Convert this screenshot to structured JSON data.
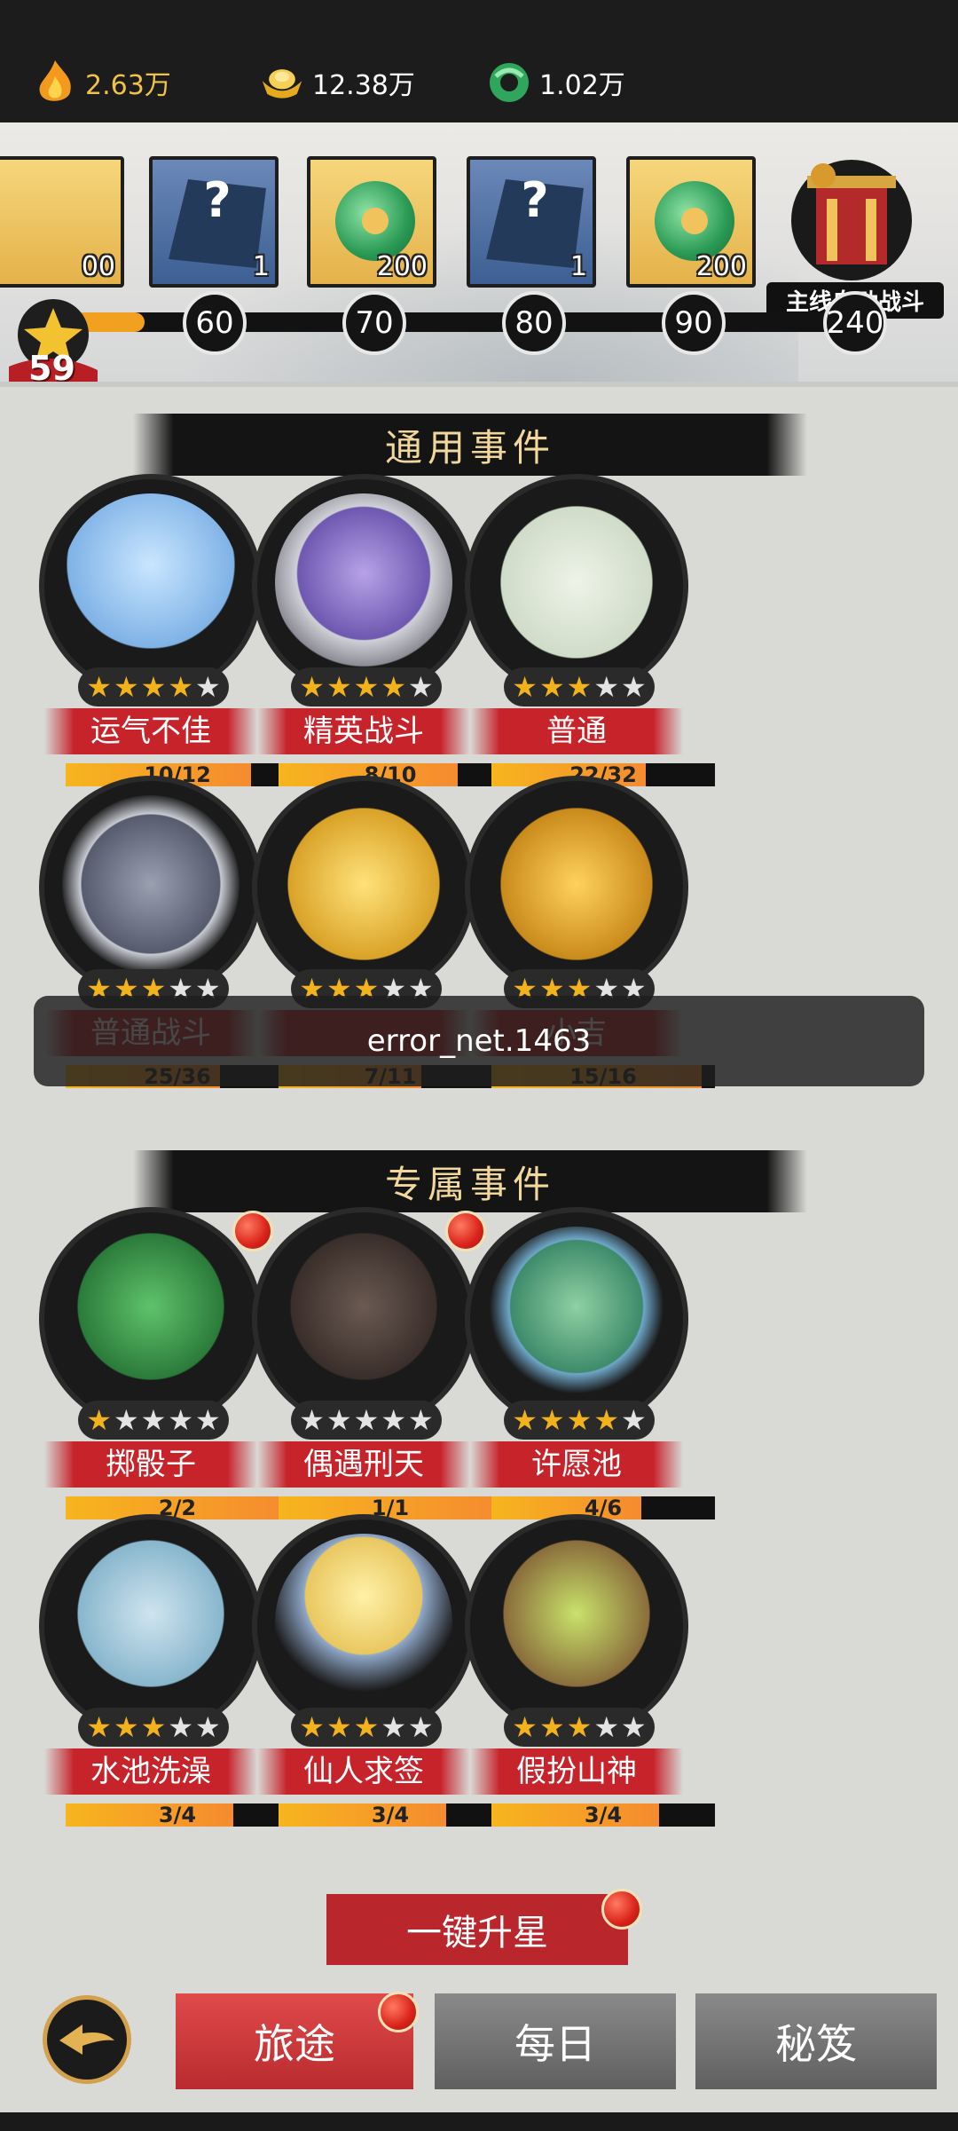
{
  "resources": [
    {
      "icon": "fire-icon",
      "value": "2.63万"
    },
    {
      "icon": "gold-ingot-icon",
      "value": "12.38万"
    },
    {
      "icon": "jade-icon",
      "value": "1.02万"
    }
  ],
  "track": {
    "level": "59",
    "partial_count": "00",
    "rewards": [
      {
        "type": "mystery",
        "count": "1"
      },
      {
        "type": "jade",
        "count": "200"
      },
      {
        "type": "mystery",
        "count": "1"
      },
      {
        "type": "jade",
        "count": "200"
      }
    ],
    "ticks": [
      "60",
      "70",
      "80",
      "90",
      "240"
    ],
    "progress_fraction": 0.09,
    "auto_battle_label": "主线自动战斗"
  },
  "sections": {
    "common_title": "通用事件",
    "exclusive_title": "专属事件"
  },
  "common_events": [
    {
      "name": "运气不佳",
      "stars": 4,
      "progress": "10/12",
      "ratio": 0.83,
      "art": "ghost"
    },
    {
      "name": "精英战斗",
      "stars": 4,
      "progress": "8/10",
      "ratio": 0.8,
      "art": "skull"
    },
    {
      "name": "普通",
      "stars": 3,
      "progress": "22/32",
      "ratio": 0.69,
      "art": "scroll"
    },
    {
      "name": "普通战斗",
      "stars": 3,
      "progress": "25/36",
      "ratio": 0.69,
      "art": "mask"
    },
    {
      "name": "",
      "stars": 3,
      "progress": "7/11",
      "ratio": 0.64,
      "art": "bronze"
    },
    {
      "name": "小吉",
      "stars": 3,
      "progress": "15/16",
      "ratio": 0.94,
      "art": "beast"
    }
  ],
  "exclusive_events": [
    {
      "name": "掷骰子",
      "stars": 1,
      "progress": "2/2",
      "ratio": 1.0,
      "art": "frog",
      "badge": true
    },
    {
      "name": "偶遇刑天",
      "stars": 0,
      "progress": "1/1",
      "ratio": 1.0,
      "art": "xingtian",
      "badge": true
    },
    {
      "name": "许愿池",
      "stars": 4,
      "progress": "4/6",
      "ratio": 0.67,
      "art": "toad",
      "badge": false
    },
    {
      "name": "水池洗澡",
      "stars": 3,
      "progress": "3/4",
      "ratio": 0.75,
      "art": "girl",
      "badge": false
    },
    {
      "name": "仙人求签",
      "stars": 3,
      "progress": "3/4",
      "ratio": 0.75,
      "art": "sage",
      "badge": false
    },
    {
      "name": "假扮山神",
      "stars": 3,
      "progress": "3/4",
      "ratio": 0.75,
      "art": "mountain-god",
      "badge": false
    }
  ],
  "toast": "error_net.1463",
  "upgrade_button": "一键升星",
  "nav": {
    "journey": "旅途",
    "daily": "每日",
    "secrets": "秘笈"
  },
  "colors": {
    "accent_red": "#c6232b",
    "progress_orange": "#f2a020",
    "banner_text": "#f1d79c"
  }
}
